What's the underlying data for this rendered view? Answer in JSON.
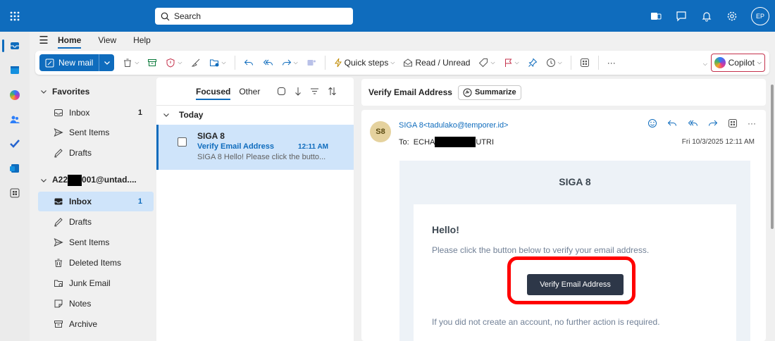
{
  "topbar": {
    "search_placeholder": "Search",
    "avatar_initials": "EP"
  },
  "ribbon": {
    "tabs": [
      "Home",
      "View",
      "Help"
    ],
    "new_mail": "New mail",
    "quick_steps": "Quick steps",
    "read_unread": "Read / Unread",
    "more": "···",
    "copilot": "Copilot"
  },
  "folders": {
    "favorites_label": "Favorites",
    "favorites": [
      {
        "label": "Inbox",
        "count": "1"
      },
      {
        "label": "Sent Items"
      },
      {
        "label": "Drafts"
      }
    ],
    "account_prefix": "A22",
    "account_suffix": "001@untad....",
    "account_items": [
      {
        "label": "Inbox",
        "count": "1"
      },
      {
        "label": "Drafts"
      },
      {
        "label": "Sent Items"
      },
      {
        "label": "Deleted Items"
      },
      {
        "label": "Junk Email"
      },
      {
        "label": "Notes"
      },
      {
        "label": "Archive"
      }
    ]
  },
  "message_list": {
    "tab_focused": "Focused",
    "tab_other": "Other",
    "group_today": "Today",
    "message": {
      "from": "SIGA 8",
      "subject": "Verify Email Address",
      "time": "12:11 AM",
      "preview": "SIGA 8 Hello! Please click the butto..."
    }
  },
  "reading": {
    "subject": "Verify Email Address",
    "summarize": "Summarize",
    "sender_initials": "S8",
    "sender": "SIGA 8<tadulako@temporer.id>",
    "to_prefix": "To:  ECHA",
    "to_suffix": "UTRI",
    "date": "Fri 10/3/2025 12:11 AM",
    "body": {
      "header": "SIGA 8",
      "greeting": "Hello!",
      "instruction": "Please click the button below to verify your email address.",
      "button": "Verify Email Address",
      "footer": "If you did not create an account, no further action is required."
    }
  },
  "colors": {
    "brand": "#0f6cbd",
    "highlight_box": "#ff0000",
    "email_button": "#2d3748"
  }
}
